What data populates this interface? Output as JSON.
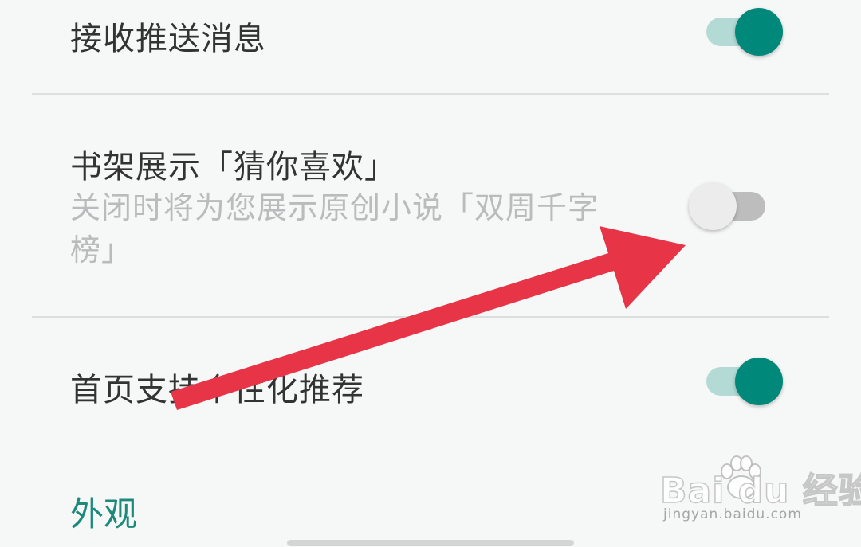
{
  "settings": {
    "push": {
      "title": "接收推送消息",
      "enabled": true
    },
    "bookshelf": {
      "title": "书架展示「猜你喜欢」",
      "description": "关闭时将为您展示原创小说「双周千字榜」",
      "enabled": false
    },
    "homepage": {
      "title": "首页支持个性化推荐",
      "enabled": true
    }
  },
  "section": {
    "appearance_label": "外观"
  },
  "watermark": {
    "logo": "Bai du 经验",
    "url": "jingyan.baidu.com"
  },
  "colors": {
    "accent": "#00897b",
    "accent_track": "#b3dad4",
    "arrow": "#e73446",
    "background": "#f6f7f7"
  }
}
